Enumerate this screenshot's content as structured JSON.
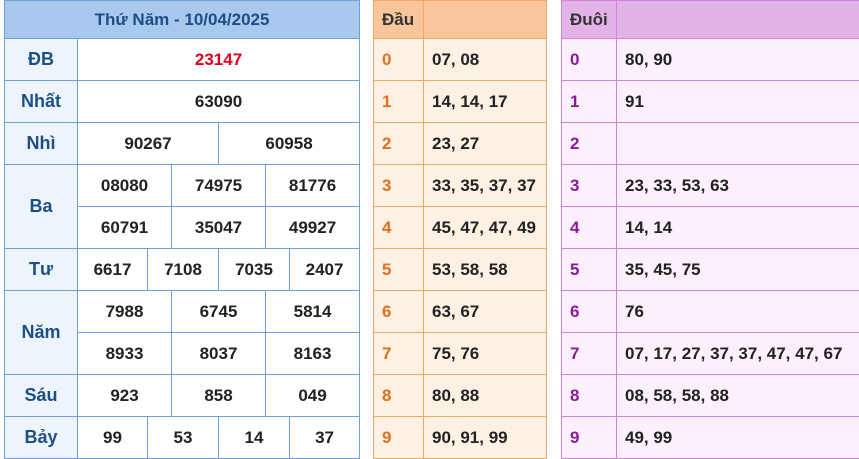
{
  "results": {
    "title": "Thứ Năm - 10/04/2025",
    "rows": {
      "db": {
        "label": "ĐB",
        "values": [
          "23147"
        ]
      },
      "nhat": {
        "label": "Nhất",
        "values": [
          "63090"
        ]
      },
      "nhi": {
        "label": "Nhì",
        "values": [
          "90267",
          "60958"
        ]
      },
      "ba": {
        "label": "Ba",
        "values": [
          "08080",
          "74975",
          "81776",
          "60791",
          "35047",
          "49927"
        ]
      },
      "tu": {
        "label": "Tư",
        "values": [
          "6617",
          "7108",
          "7035",
          "2407"
        ]
      },
      "nam": {
        "label": "Năm",
        "values": [
          "7988",
          "6745",
          "5814",
          "8933",
          "8037",
          "8163"
        ]
      },
      "sau": {
        "label": "Sáu",
        "values": [
          "923",
          "858",
          "049"
        ]
      },
      "bay": {
        "label": "Bảy",
        "values": [
          "99",
          "53",
          "14",
          "37"
        ]
      }
    },
    "special_color": "#e0001b"
  },
  "dau": {
    "header": "Đầu",
    "rows": [
      {
        "digit": "0",
        "values": "07, 08"
      },
      {
        "digit": "1",
        "values": "14, 14, 17"
      },
      {
        "digit": "2",
        "values": "23, 27"
      },
      {
        "digit": "3",
        "values": "33, 35, 37, 37"
      },
      {
        "digit": "4",
        "values": "45, 47, 47, 49"
      },
      {
        "digit": "5",
        "values": "53, 58, 58"
      },
      {
        "digit": "6",
        "values": "63, 67"
      },
      {
        "digit": "7",
        "values": "75, 76"
      },
      {
        "digit": "8",
        "values": "80, 88"
      },
      {
        "digit": "9",
        "values": "90, 91, 99"
      }
    ]
  },
  "duoi": {
    "header": "Đuôi",
    "rows": [
      {
        "digit": "0",
        "values": "80, 90"
      },
      {
        "digit": "1",
        "values": "91"
      },
      {
        "digit": "2",
        "values": ""
      },
      {
        "digit": "3",
        "values": "23, 33, 53, 63"
      },
      {
        "digit": "4",
        "values": "14, 14"
      },
      {
        "digit": "5",
        "values": "35, 45, 75"
      },
      {
        "digit": "6",
        "values": "76"
      },
      {
        "digit": "7",
        "values": "07, 17, 27, 37, 37, 47, 47, 67"
      },
      {
        "digit": "8",
        "values": "08, 58, 58, 88"
      },
      {
        "digit": "9",
        "values": "49, 99"
      }
    ]
  }
}
